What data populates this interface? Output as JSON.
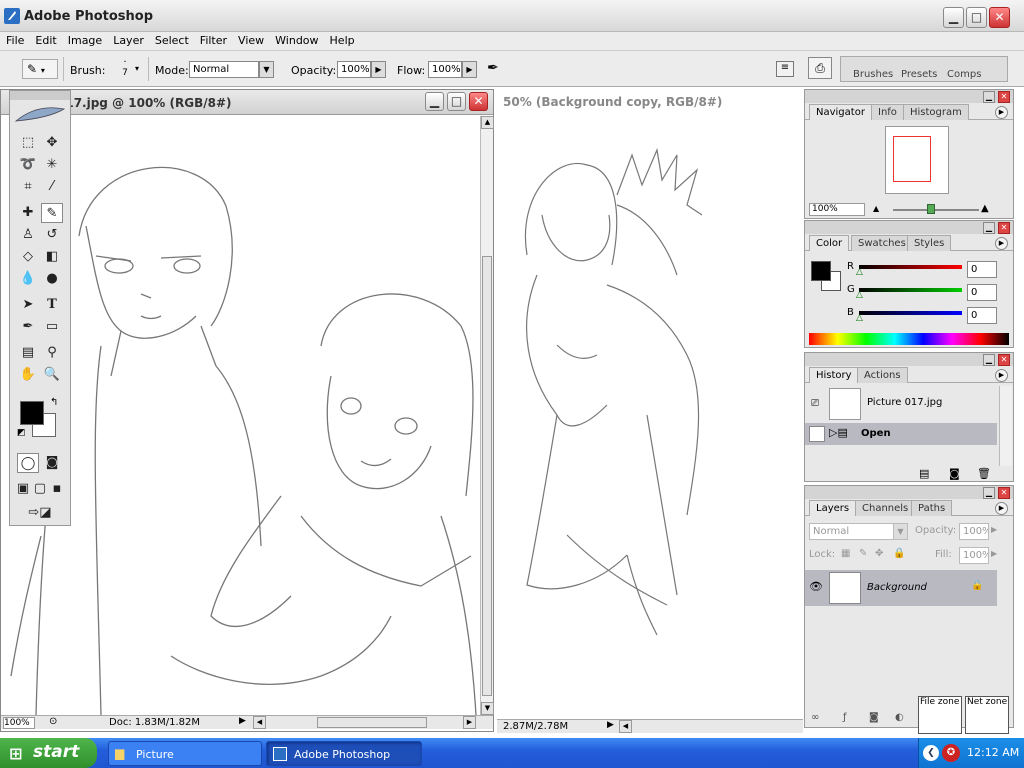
{
  "app": {
    "title": "Adobe Photoshop"
  },
  "menu": [
    "File",
    "Edit",
    "Image",
    "Layer",
    "Select",
    "Filter",
    "View",
    "Window",
    "Help"
  ],
  "options": {
    "brush_label": "Brush:",
    "brush_size": "7",
    "mode_label": "Mode:",
    "mode_value": "Normal",
    "opacity_label": "Opacity:",
    "opacity_value": "100%",
    "flow_label": "Flow:",
    "flow_value": "100%"
  },
  "well_tabs": [
    "Brushes",
    "Presets",
    "Comps"
  ],
  "doc1": {
    "title": "017.jpg @ 100% (RGB/8#)",
    "zoom": "100%",
    "doc_info": "Doc: 1.83M/1.82M"
  },
  "doc2": {
    "title": "50% (Background copy, RGB/8#)",
    "doc_info": "2.87M/2.78M"
  },
  "navigator": {
    "tabs": [
      "Navigator",
      "Info",
      "Histogram"
    ],
    "zoom": "100%"
  },
  "color": {
    "tabs": [
      "Color",
      "Swatches",
      "Styles"
    ],
    "r_label": "R",
    "g_label": "G",
    "b_label": "B",
    "r": "0",
    "g": "0",
    "b": "0"
  },
  "history": {
    "tabs": [
      "History",
      "Actions"
    ],
    "snapshot": "Picture 017.jpg",
    "step": "Open"
  },
  "layers": {
    "tabs": [
      "Layers",
      "Channels",
      "Paths"
    ],
    "blend": "Normal",
    "opacity_label": "Opacity:",
    "opacity": "100%",
    "lock_label": "Lock:",
    "fill_label": "Fill:",
    "fill": "100%",
    "layer_name": "Background"
  },
  "zones": {
    "file": "File zone",
    "net": "Net zone"
  },
  "taskbar": {
    "start": "start",
    "items": [
      "Picture",
      "Adobe Photoshop"
    ],
    "clock": "12:12 AM"
  },
  "colors": {
    "accent": "#3f8cf3",
    "close_red": "#d44444",
    "start_green": "#3fa83c"
  }
}
